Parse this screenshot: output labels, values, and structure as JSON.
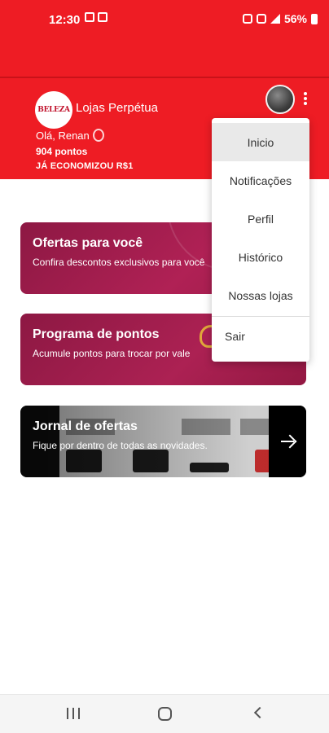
{
  "status_bar": {
    "time": "12:30",
    "battery": "56%",
    "icons": [
      "gmail-icon",
      "image-icon",
      "alarm-icon",
      "wifi-icon",
      "signal-icon",
      "battery-icon"
    ]
  },
  "header": {
    "logo_text": "BELEZA",
    "store_name": "Lojas Perpétua",
    "greeting": "Olá, Renan",
    "points": "904 pontos",
    "savings": "JÁ ECONOMIZOU R$1"
  },
  "cards": [
    {
      "title": "Ofertas para você",
      "subtitle": "Confira descontos exclusivos para você"
    },
    {
      "title": "Programa de pontos",
      "subtitle": "Acumule pontos para trocar por vale"
    },
    {
      "title": "Jornal de ofertas",
      "subtitle": "Fique por dentro de todas as novidades."
    }
  ],
  "menu": {
    "items": [
      "Inicio",
      "Notificações",
      "Perfil",
      "Histórico",
      "Nossas lojas",
      "Sair"
    ],
    "active": "Inicio"
  },
  "colors": {
    "brand_red": "#ee1c24",
    "card_wine": "#9a1a47",
    "journal_dark": "#111111"
  }
}
